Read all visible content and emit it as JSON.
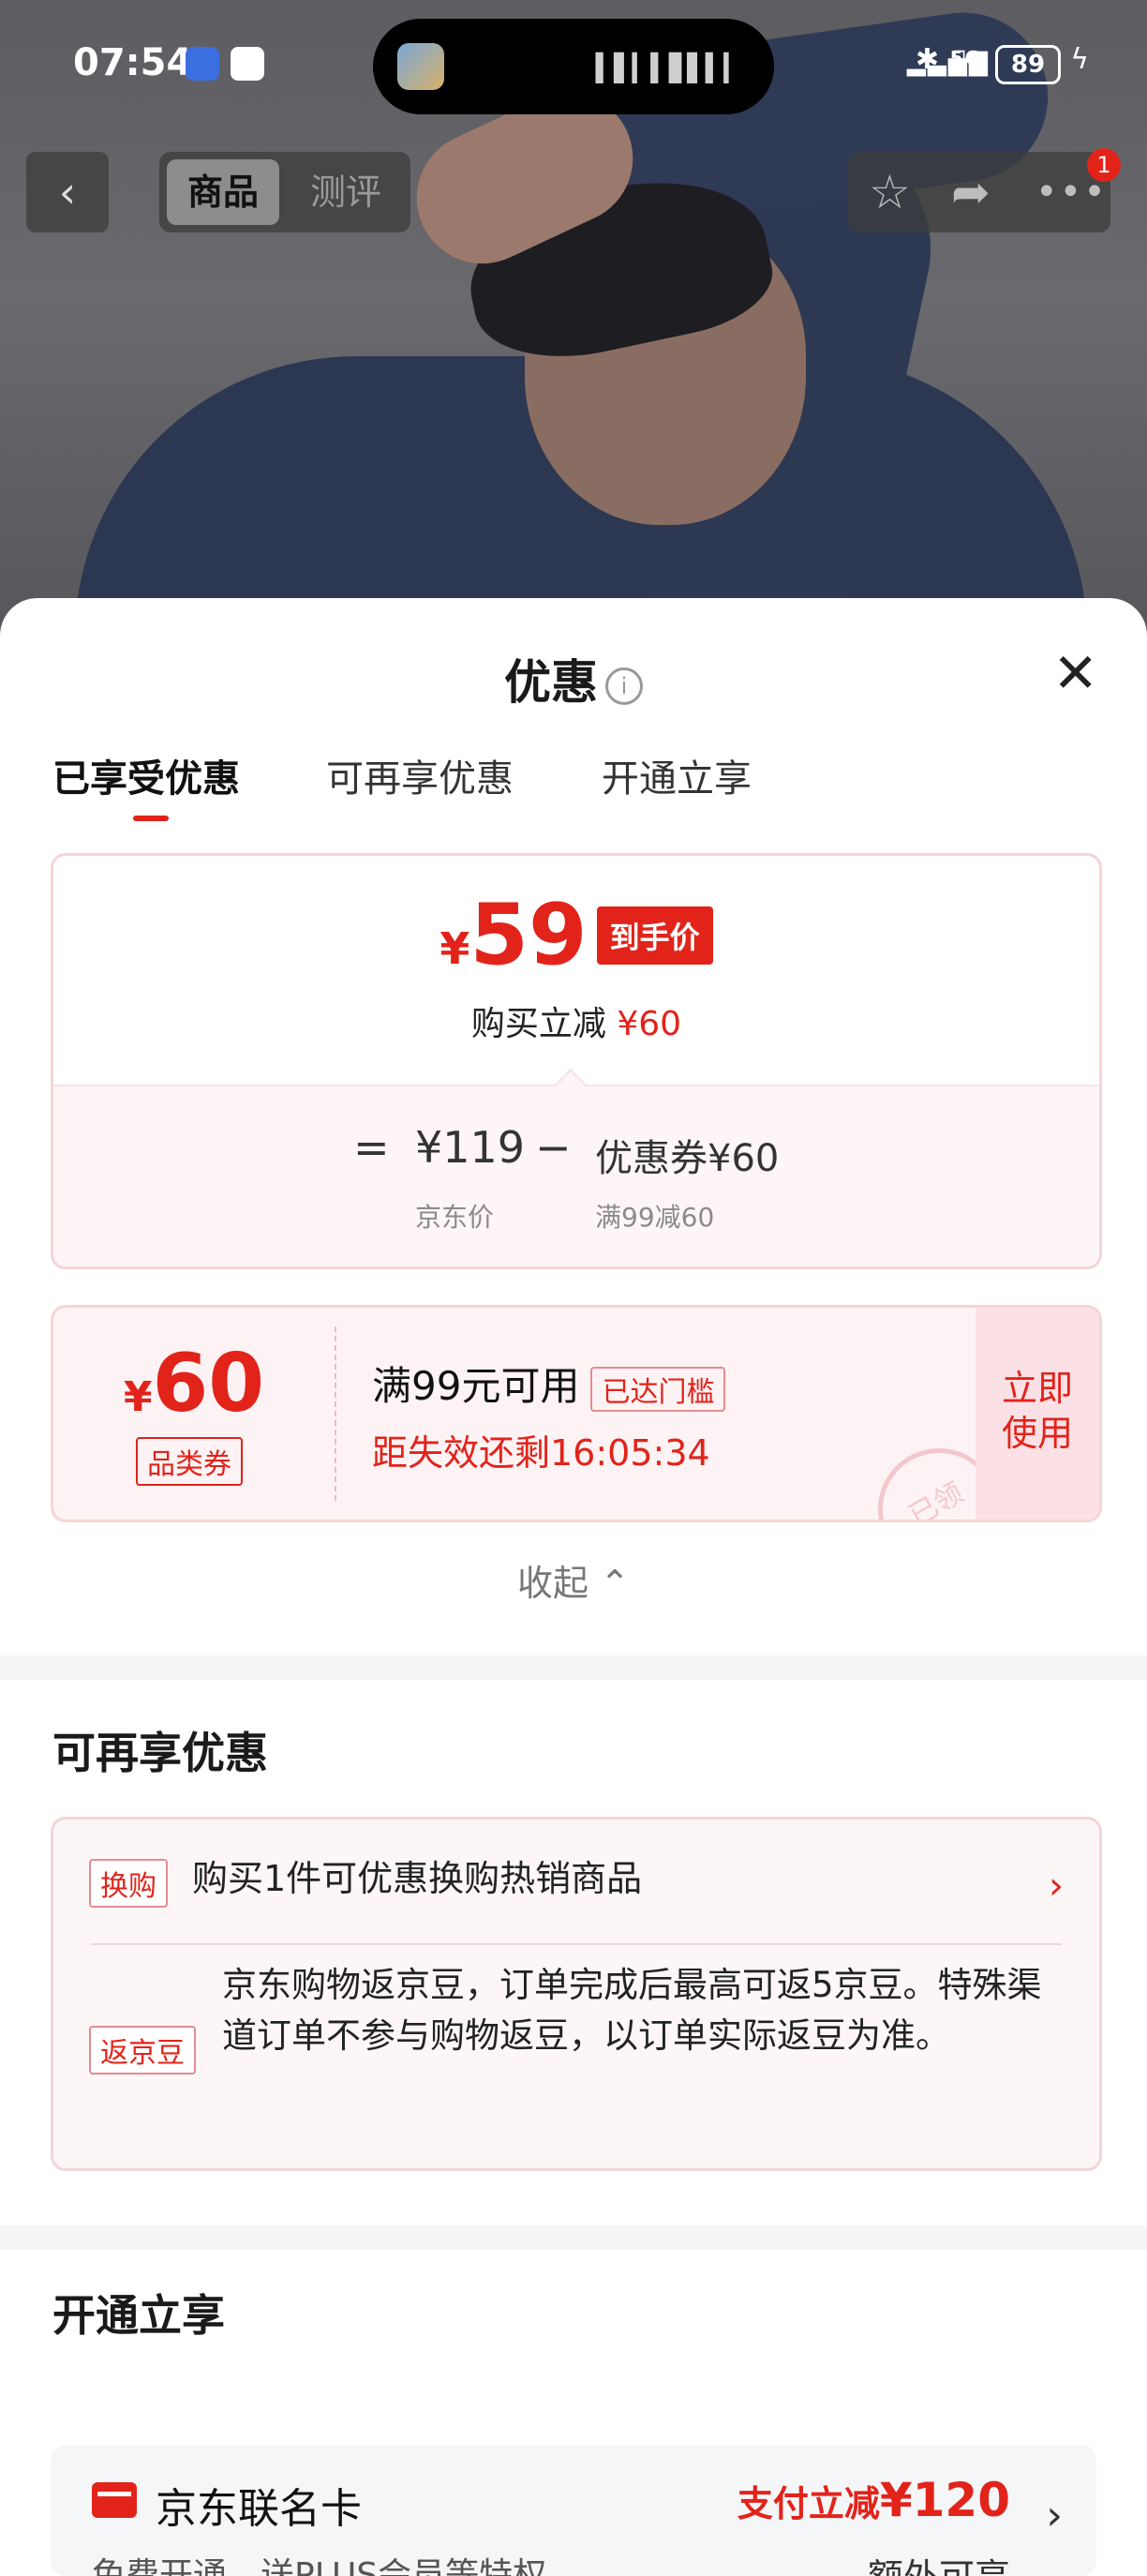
{
  "status_bar": {
    "time": "07:54",
    "network": "5G",
    "battery": "89"
  },
  "nav": {
    "tabs": [
      "商品",
      "测评"
    ],
    "cart_count": "1"
  },
  "sheet": {
    "title": "优惠",
    "tabs": [
      "已享受优惠",
      "可再享优惠",
      "开通立享"
    ],
    "final_price": {
      "currency": "¥",
      "value": "59",
      "tag": "到手价"
    },
    "reduction": {
      "label": "购买立减",
      "amount": "¥60"
    },
    "breakdown": {
      "eq": "=",
      "price": "¥119",
      "price_label": "京东价",
      "minus": "−",
      "coupon": "优惠券¥60",
      "coupon_label": "满99减60"
    },
    "coupon": {
      "currency": "¥",
      "amount": "60",
      "type": "品类券",
      "condition": "满99元可用",
      "reached": "已达门槛",
      "expire": "距失效还剩16:05:34",
      "use_line1": "立即",
      "use_line2": "使用",
      "stamp": "已领"
    },
    "collapse": "收起 ⌃"
  },
  "more_offers": {
    "title": "可再享优惠",
    "items": [
      {
        "tag": "换购",
        "text": "购买1件可优惠换购热销商品"
      },
      {
        "tag": "返京豆",
        "text": "京东购物返京豆，订单完成后最高可返5京豆。特殊渠道订单不参与购物返豆，以订单实际返豆为准。"
      }
    ]
  },
  "instant": {
    "title": "开通立享",
    "card": {
      "name": "京东联名卡",
      "sub": "免费开通，送PLUS会员等特权",
      "pay_label": "支付立减",
      "pay_amount": "¥120",
      "extra": "额外可享"
    }
  },
  "colors": {
    "accent": "#e2231a",
    "coupon_bg": "#fdf3f4"
  }
}
